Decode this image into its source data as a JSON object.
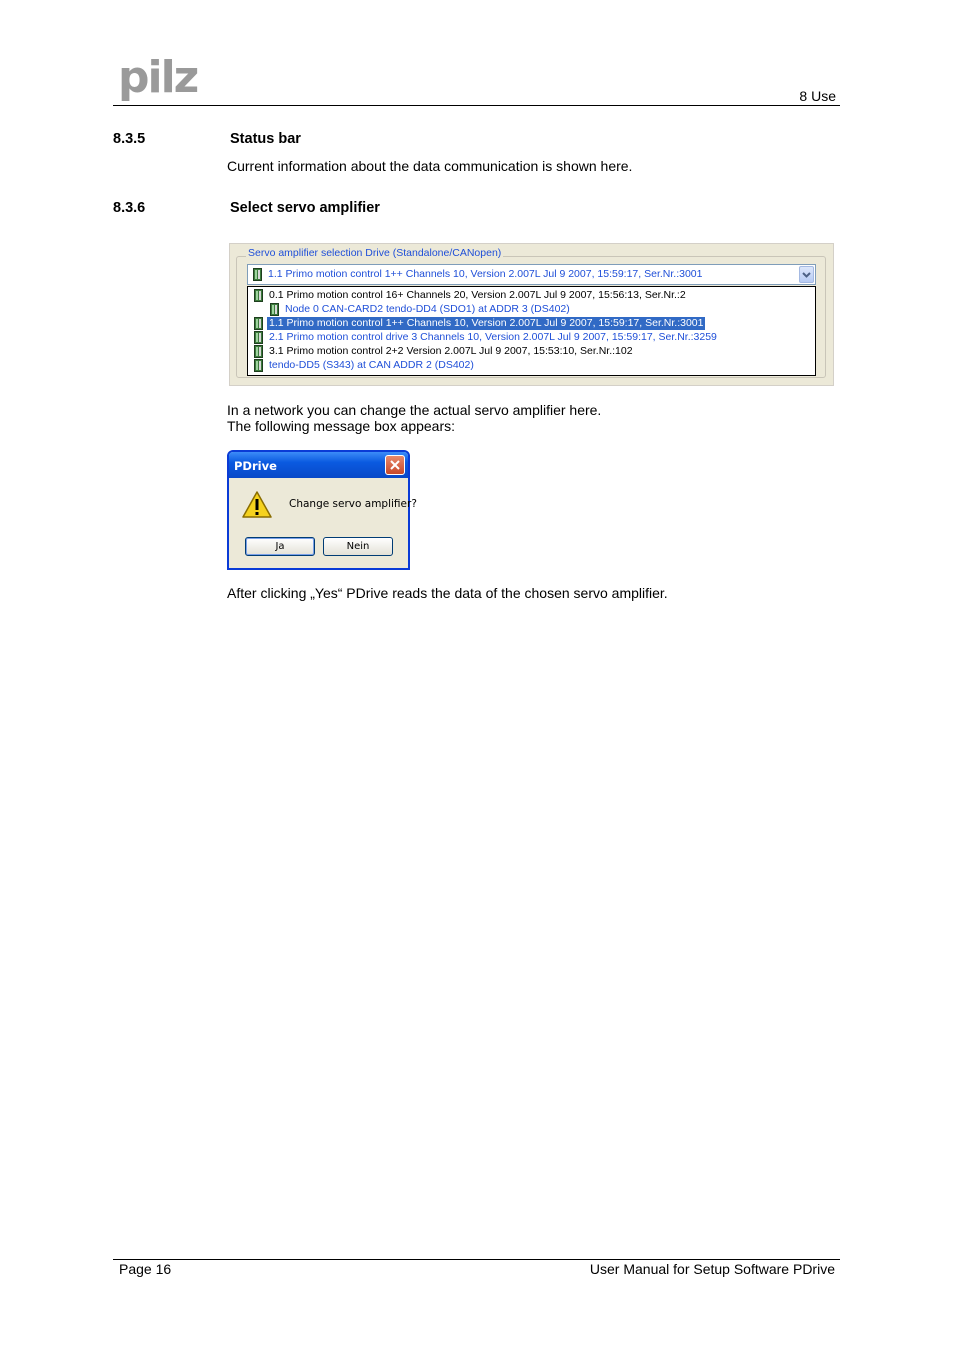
{
  "header": {
    "logo_text": "pilz",
    "chapter": "8  Use"
  },
  "section_835": {
    "number": "8.3.5",
    "title": "Status bar",
    "body": "Current information about the data communication is shown here."
  },
  "section_836": {
    "number": "8.3.6",
    "title": "Select servo amplifier",
    "panel": {
      "group_label": "Servo amplifier selection Drive (Standalone/CANopen)",
      "combo_value": "1.1 Primo motion control 1++ Channels 10, Version 2.007L Jul  9 2007, 15:59:17, Ser.Nr.:3001",
      "items": [
        {
          "text": "0.1 Primo motion control 16+ Channels 20, Version 2.007L Jul  9 2007, 15:56:13, Ser.Nr.:2",
          "color": "#000000",
          "selected": false
        },
        {
          "text": "Node 0 CAN-CARD2 tendo-DD4 (SDO1) at ADDR 3 (DS402)",
          "color": "#1f4fd8",
          "selected": false
        },
        {
          "text": "1.1 Primo motion control 1++ Channels 10, Version 2.007L Jul  9 2007, 15:59:17, Ser.Nr.:3001",
          "color": "#ffffff",
          "selected": true
        },
        {
          "text": "2.1 Primo motion control drive 3 Channels 10, Version 2.007L Jul  9 2007, 15:59:17, Ser.Nr.:3259",
          "color": "#1f4fd8",
          "selected": false
        },
        {
          "text": "3.1 Primo motion control 2+2 Version 2.007L Jul  9 2007, 15:53:10, Ser.Nr.:102",
          "color": "#000000",
          "selected": false
        },
        {
          "text": "tendo-DD5 (S343) at CAN ADDR 2 (DS402)",
          "color": "#1f4fd8",
          "selected": false
        }
      ]
    },
    "para1_line1": "In a network you can change the actual servo amplifier here.",
    "para1_line2": "The following message box appears:",
    "dialog": {
      "title": "PDrive",
      "message": "Change servo amplifier?",
      "yes_label": "Ja",
      "no_label": "Nein"
    },
    "para2": "After clicking „Yes“ PDrive reads the data of the chosen servo amplifier."
  },
  "footer": {
    "page": "Page 16",
    "doc_title": "User Manual for Setup Software PDrive"
  }
}
